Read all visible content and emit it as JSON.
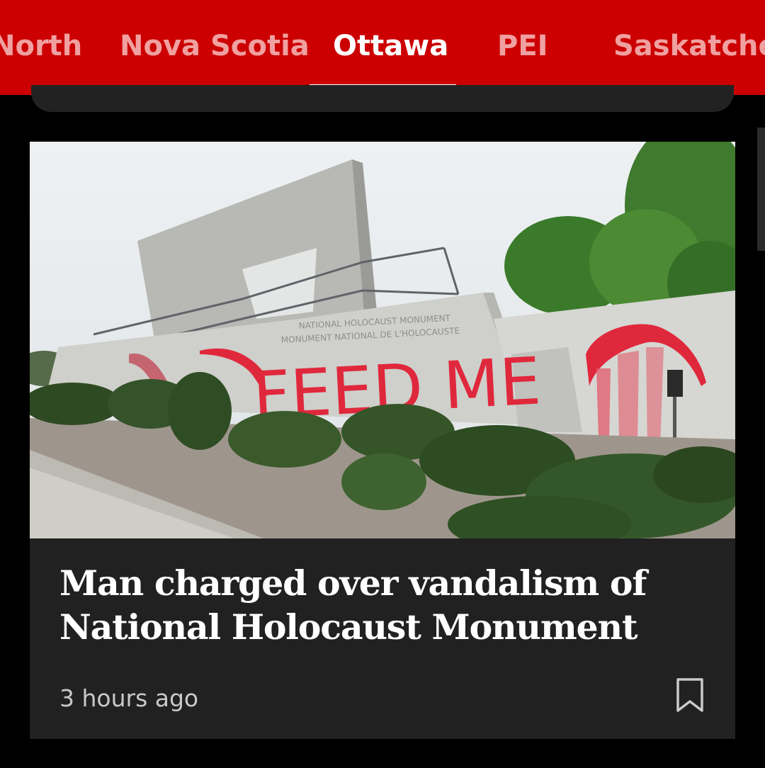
{
  "tabs": [
    {
      "label": "North",
      "active": false
    },
    {
      "label": "Nova Scotia",
      "active": false
    },
    {
      "label": "Ottawa",
      "active": true
    },
    {
      "label": "PEI",
      "active": false
    },
    {
      "label": "Saskatchewan",
      "active": false
    }
  ],
  "article": {
    "headline": "Man charged over vandalism of National Holocaust Monument",
    "timestamp": "3 hours ago",
    "image": {
      "sign_line_1": "NATIONAL HOLOCAUST MONUMENT",
      "sign_line_2": "MONUMENT NATIONAL DE L'HOLOCAUSTE",
      "graffiti": "FEED ME"
    },
    "bookmark_icon": "bookmark-icon"
  },
  "colors": {
    "brand_red": "#cc0000",
    "inactive_tab": "#f0a0a0",
    "card_bg": "#212121",
    "graffiti_red": "#e0283c"
  }
}
